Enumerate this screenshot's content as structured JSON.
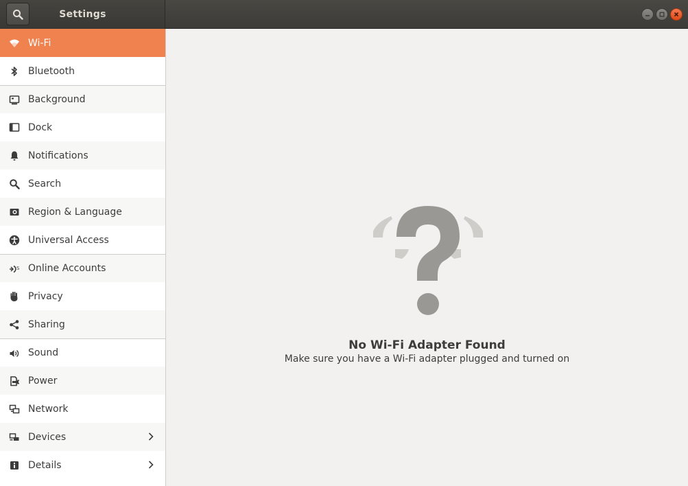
{
  "header": {
    "title": "Settings",
    "search_icon": "search-icon",
    "window_buttons": [
      "minimize-icon",
      "maximize-icon",
      "close-icon"
    ]
  },
  "colors": {
    "accent": "#f0824f",
    "header_bg": "#3d3b37",
    "close_button": "#df4a16",
    "content_bg": "#f2f1f0"
  },
  "sidebar": {
    "items": [
      {
        "label": "Wi-Fi",
        "icon": "wifi-icon",
        "selected": true
      },
      {
        "label": "Bluetooth",
        "icon": "bluetooth-icon"
      },
      {
        "label": "Background",
        "icon": "background-icon"
      },
      {
        "label": "Dock",
        "icon": "dock-icon"
      },
      {
        "label": "Notifications",
        "icon": "bell-icon"
      },
      {
        "label": "Search",
        "icon": "search-icon"
      },
      {
        "label": "Region & Language",
        "icon": "region-icon"
      },
      {
        "label": "Universal Access",
        "icon": "accessibility-icon"
      },
      {
        "label": "Online Accounts",
        "icon": "online-accounts-icon"
      },
      {
        "label": "Privacy",
        "icon": "hand-icon"
      },
      {
        "label": "Sharing",
        "icon": "share-icon"
      },
      {
        "label": "Sound",
        "icon": "speaker-icon"
      },
      {
        "label": "Power",
        "icon": "power-icon"
      },
      {
        "label": "Network",
        "icon": "network-icon"
      },
      {
        "label": "Devices",
        "icon": "devices-icon",
        "has_submenu": true
      },
      {
        "label": "Details",
        "icon": "info-icon",
        "has_submenu": true
      }
    ]
  },
  "main": {
    "placeholder_icon": "question-mark-icon",
    "empty_title": "No Wi-Fi Adapter Found",
    "empty_subtitle": "Make sure you have a Wi-Fi adapter plugged and turned on"
  }
}
